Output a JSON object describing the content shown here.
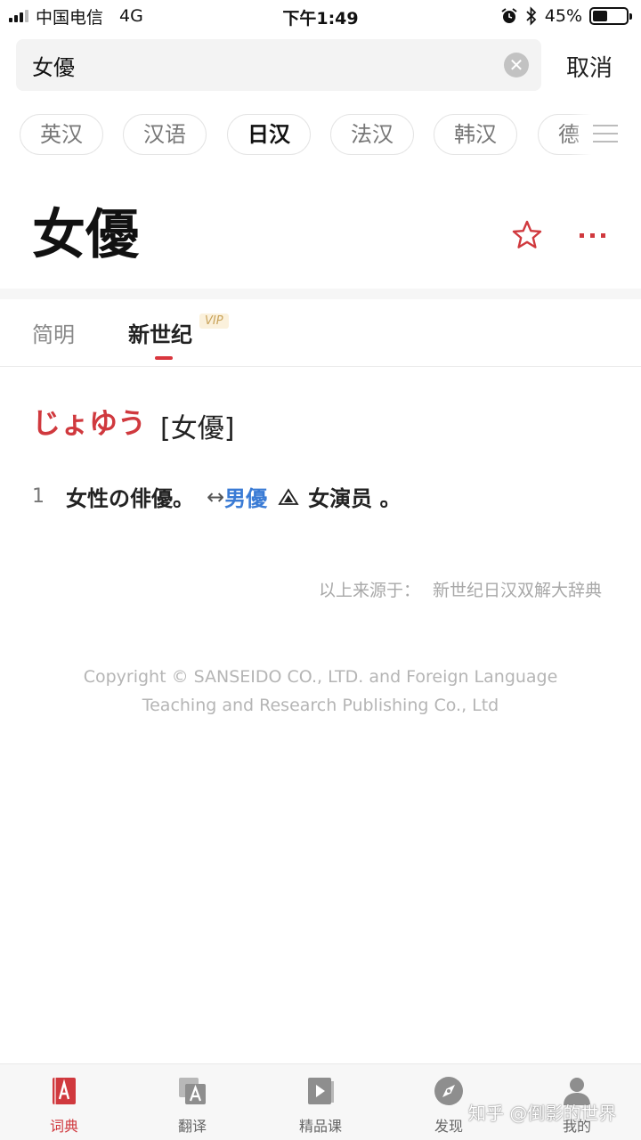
{
  "status_bar": {
    "carrier": "中国电信",
    "network": "4G",
    "time": "下午1:49",
    "battery_percent": "45%",
    "battery_level": 0.45
  },
  "search": {
    "query": "女優",
    "cancel_label": "取消"
  },
  "language_tabs": [
    {
      "label": "英汉",
      "active": false
    },
    {
      "label": "汉语",
      "active": false
    },
    {
      "label": "日汉",
      "active": true
    },
    {
      "label": "法汉",
      "active": false
    },
    {
      "label": "韩汉",
      "active": false
    },
    {
      "label": "德",
      "active": false
    }
  ],
  "entry": {
    "headword": "女優",
    "reading": "じょゆう",
    "kanji": "[女優]"
  },
  "dictionary_tabs": [
    {
      "label": "简明",
      "active": false
    },
    {
      "label": "新世纪",
      "active": true,
      "badge": "VIP"
    }
  ],
  "sense": {
    "number": "1",
    "text": "女性の俳優。",
    "arrow": "↔",
    "cross_ref": "男優",
    "translation": "女演员 。"
  },
  "source": {
    "label": "以上来源于：",
    "name": "新世纪日汉双解大辞典"
  },
  "copyright": {
    "line1": "Copyright © SANSEIDO CO., LTD. and Foreign Language",
    "line2": "Teaching and Research Publishing Co., Ltd"
  },
  "bottom_nav": [
    {
      "label": "词典",
      "icon": "dictionary-icon",
      "active": true
    },
    {
      "label": "翻译",
      "icon": "translate-icon",
      "active": false
    },
    {
      "label": "精品课",
      "icon": "course-icon",
      "active": false
    },
    {
      "label": "发现",
      "icon": "compass-icon",
      "active": false
    },
    {
      "label": "我的",
      "icon": "user-icon",
      "active": false
    }
  ],
  "watermark": "知乎 @倒影的世界",
  "colors": {
    "accent": "#d0393e",
    "link": "#3a7bd5",
    "vip": "#c9a35a"
  }
}
